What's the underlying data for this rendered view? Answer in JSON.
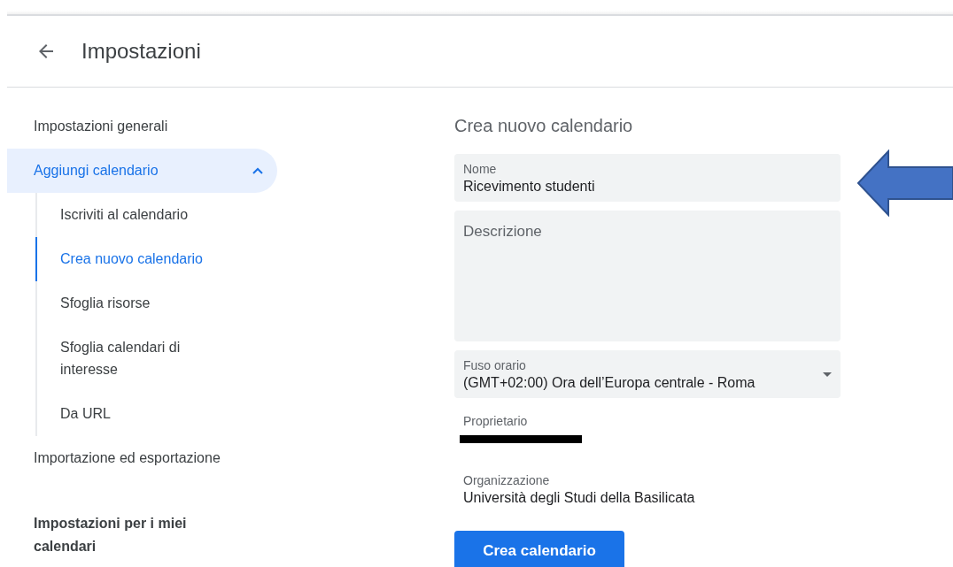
{
  "header": {
    "title": "Impostazioni"
  },
  "sidebar": {
    "items": [
      {
        "label": "Impostazioni generali",
        "selected": false
      },
      {
        "label": "Aggiungi calendario",
        "selected": true,
        "expanded": true,
        "children": [
          {
            "label": "Iscriviti al calendario",
            "selected": false
          },
          {
            "label": "Crea nuovo calendario",
            "selected": true
          },
          {
            "label": "Sfoglia risorse",
            "selected": false
          },
          {
            "label": "Sfoglia calendari di interesse",
            "selected": false
          },
          {
            "label": "Da URL",
            "selected": false
          }
        ]
      },
      {
        "label": "Importazione ed esportazione",
        "selected": false
      }
    ],
    "section_heading": "Impostazioni per i miei calendari"
  },
  "form": {
    "title": "Crea nuovo calendario",
    "name": {
      "label": "Nome",
      "value": "Ricevimento studenti"
    },
    "description": {
      "placeholder": "Descrizione"
    },
    "timezone": {
      "label": "Fuso orario",
      "value": "(GMT+02:00) Ora dell’Europa centrale - Roma"
    },
    "owner": {
      "label": "Proprietario"
    },
    "organization": {
      "label": "Organizzazione",
      "value": "Università degli Studi della Basilicata"
    },
    "submit": "Crea calendario"
  }
}
